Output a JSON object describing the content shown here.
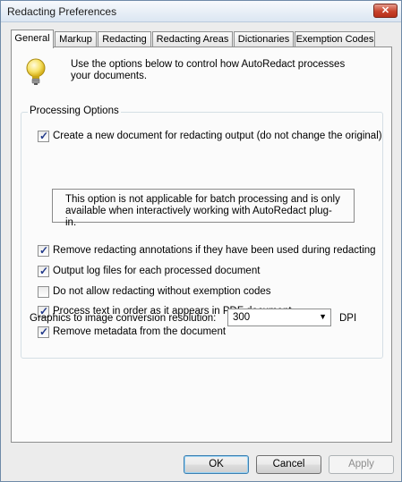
{
  "window": {
    "title": "Redacting Preferences",
    "close_label": "✕"
  },
  "tabs": [
    {
      "label": "General",
      "active": true
    },
    {
      "label": "Markup"
    },
    {
      "label": "Redacting"
    },
    {
      "label": "Redacting Areas"
    },
    {
      "label": "Dictionaries"
    },
    {
      "label": "Exemption Codes"
    }
  ],
  "intro": {
    "text": "Use the options below to control how AutoRedact processes your documents.",
    "icon": "lightbulb-icon"
  },
  "processing": {
    "group_title": "Processing Options",
    "new_document": {
      "label": "Create a new document for redacting output (do not change the original)",
      "checked": true
    },
    "note": "This option is not applicable for batch processing and is only available when interactively working with AutoRedact plug-in.",
    "options": [
      {
        "label": "Remove redacting annotations if they have been used during redacting",
        "checked": true
      },
      {
        "label": "Output log files for each processed document",
        "checked": true
      },
      {
        "label": "Do not allow redacting without exemption codes",
        "checked": false
      },
      {
        "label": "Process text in order as it appears in PDF document",
        "checked": true
      },
      {
        "label": "Remove metadata from the document",
        "checked": true
      }
    ],
    "resolution_label": "Graphics to image conversion resolution:",
    "resolution_value": "300",
    "resolution_unit": "DPI"
  },
  "buttons": {
    "ok": "OK",
    "cancel": "Cancel",
    "apply": "Apply"
  },
  "colors": {
    "titlebar": "#dbe6f2",
    "checkmark": "#21398a",
    "close": "#c7422b"
  }
}
